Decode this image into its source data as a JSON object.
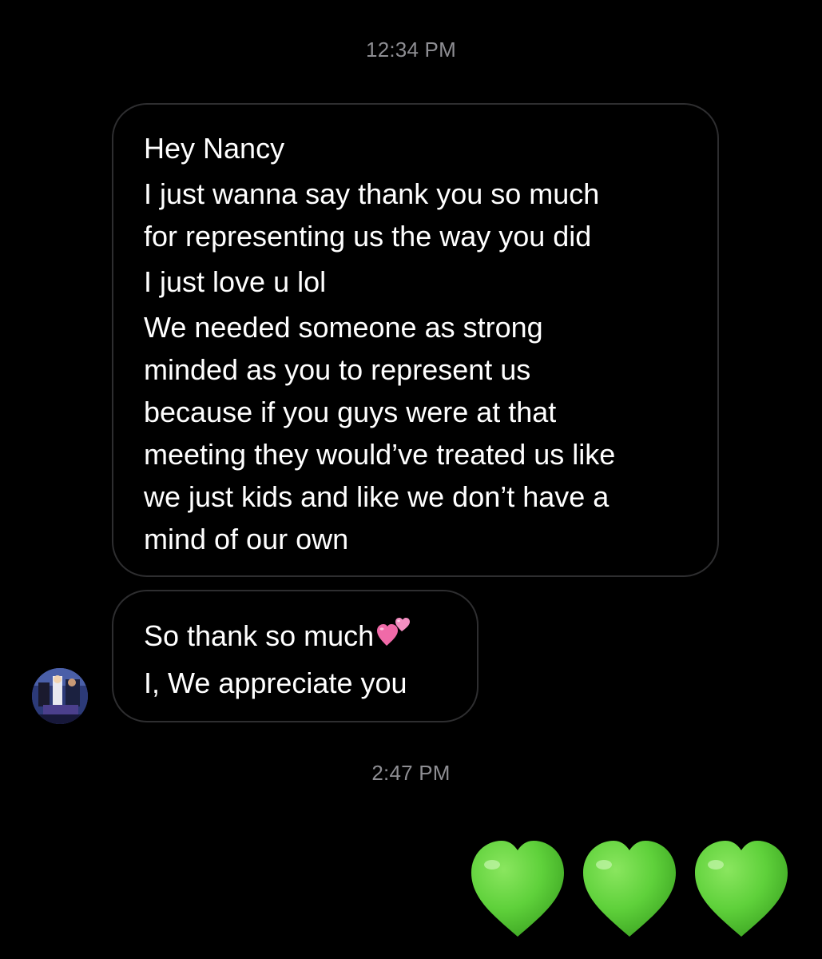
{
  "thread": {
    "timestamp_1": "12:34 PM",
    "timestamp_2": "2:47 PM"
  },
  "messages": [
    {
      "sender": "other",
      "lines": [
        "Hey Nancy",
        "I just wanna say thank you so much",
        "for representing us the way you did",
        "I just love u lol",
        "We needed someone as strong",
        "minded as you to represent us",
        "because if you guys were at that",
        "meeting they would’ve treated us like",
        "we just kids and like we don’t have a",
        "mind of our own"
      ]
    },
    {
      "sender": "other",
      "lines": [
        "So thank so much",
        "I, We appreciate you"
      ],
      "emoji": "two-hearts"
    }
  ],
  "reply": {
    "sender": "self",
    "emoji": "green-heart",
    "count": 3
  },
  "colors": {
    "background": "#000000",
    "bubble_border": "#2e2e30",
    "timestamp": "#8e8e93",
    "text": "#ffffff",
    "green_heart": "#5fd13b",
    "pink_heart": "#f06aa8"
  },
  "icons": {
    "avatar": "profile-avatar",
    "heart": "green-heart-emoji",
    "two_hearts": "two-hearts-emoji"
  }
}
